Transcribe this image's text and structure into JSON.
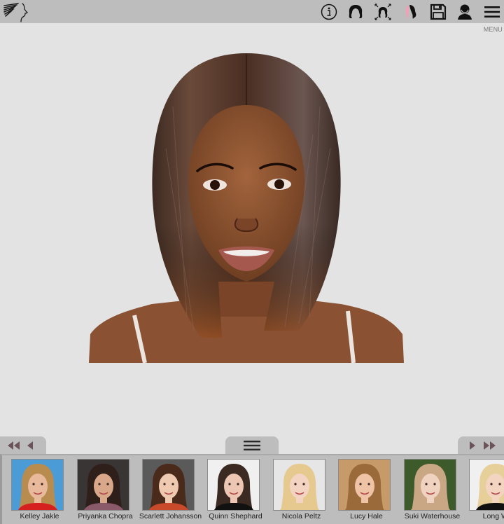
{
  "toolbar": {
    "icons": [
      {
        "name": "info-icon",
        "label": "Info"
      },
      {
        "name": "hairstyle-icon",
        "label": "Hairstyle"
      },
      {
        "name": "resize-hair-icon",
        "label": "Adjust hair"
      },
      {
        "name": "hair-color-icon",
        "label": "Hair color"
      },
      {
        "name": "save-icon",
        "label": "Save"
      },
      {
        "name": "user-photo-icon",
        "label": "Photo"
      },
      {
        "name": "menu-icon",
        "label": "Menu"
      }
    ],
    "menu_caption": "MENU"
  },
  "colors": {
    "toolbar_bg": "#bdbdbd",
    "stage_bg": "#e3e3e3",
    "arrow_color": "#6b5359",
    "hair_color_accent": "#f2a0b8"
  },
  "gallery": {
    "prev_page_label": "Previous page",
    "prev_label": "Previous",
    "next_label": "Next",
    "next_page_label": "Next page",
    "toggle_label": "Hairstyle list menu",
    "items": [
      {
        "name": "Kelley Jakle",
        "bg": "#4a9bd6",
        "hair": "#b88b4f",
        "skin": "#e8b99a",
        "shirt": "#d62020"
      },
      {
        "name": "Priyanka Chopra",
        "bg": "#3a3535",
        "hair": "#2e1f1a",
        "skin": "#d9a88a",
        "shirt": "#8a5a6a"
      },
      {
        "name": "Scarlett Johansson",
        "bg": "#5a5a5a",
        "hair": "#4a2a1a",
        "skin": "#efc9b0",
        "shirt": "#c84a2a"
      },
      {
        "name": "Quinn Shephard",
        "bg": "#f0f0f0",
        "hair": "#3a2a22",
        "skin": "#edc6b4",
        "shirt": "#111111"
      },
      {
        "name": "Nicola Peltz",
        "bg": "#e6e6e6",
        "hair": "#e6c98e",
        "skin": "#f3d3c2",
        "shirt": "#e6c98e"
      },
      {
        "name": "Lucy Hale",
        "bg": "#c79a6a",
        "hair": "#9b6a3a",
        "skin": "#efc4a6",
        "shirt": "#9b6a3a"
      },
      {
        "name": "Suki Waterhouse",
        "bg": "#3d5a2a",
        "hair": "#c9a684",
        "skin": "#f0d2c0",
        "shirt": "#c9a684"
      },
      {
        "name": "Long Wa",
        "bg": "#f0f0f0",
        "hair": "#e6cf98",
        "skin": "#f3d4c0",
        "shirt": "#111111"
      }
    ]
  }
}
